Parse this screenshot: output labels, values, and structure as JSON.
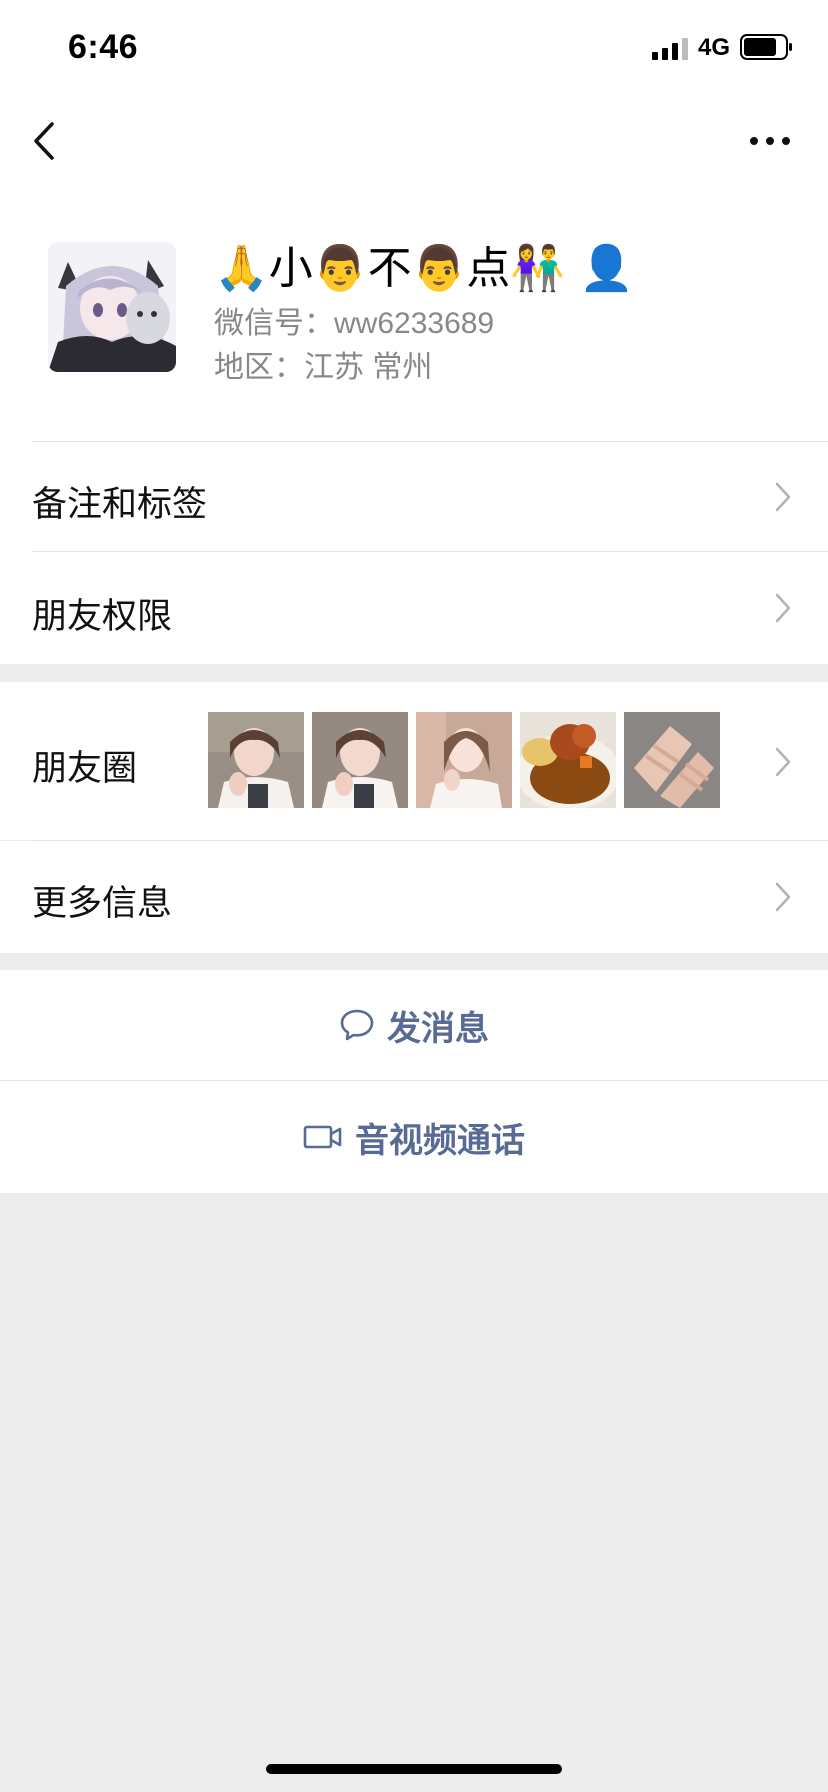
{
  "status": {
    "time": "6:46",
    "network": "4G",
    "battery_fraction": 0.8
  },
  "nav": {
    "back_icon": "chevron-left-icon",
    "more_icon": "ellipsis-icon"
  },
  "profile": {
    "name": "🙏小👨不👨点👫 👤",
    "wechat_id": "微信号：ww6233689",
    "region": "地区：江苏 常州"
  },
  "menu": {
    "remarks_tags": "备注和标签",
    "permissions": "朋友权限",
    "moments": "朋友圈",
    "more_info": "更多信息"
  },
  "actions": {
    "send_message": "发消息",
    "call": "音视频通话"
  },
  "colors": {
    "link_blue": "#576b95",
    "background": "#ededed",
    "divider": "#e5e5e5",
    "chevron": "#b2b2b2"
  }
}
